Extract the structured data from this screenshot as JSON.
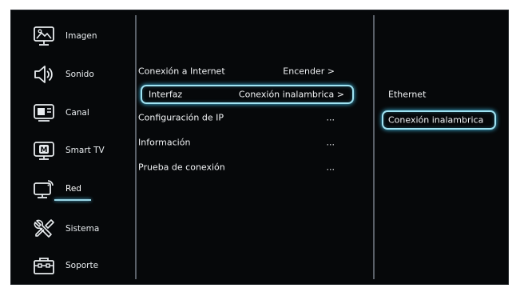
{
  "sidebar": {
    "items": [
      {
        "label": "Imagen",
        "icon": "picture-icon"
      },
      {
        "label": "Sonido",
        "icon": "speaker-icon"
      },
      {
        "label": "Canal",
        "icon": "channel-icon"
      },
      {
        "label": "Smart TV",
        "icon": "smart-tv-icon"
      },
      {
        "label": "Red",
        "icon": "network-icon"
      },
      {
        "label": "Sistema",
        "icon": "tools-icon"
      },
      {
        "label": "Soporte",
        "icon": "toolbox-icon"
      }
    ],
    "selected": "Red"
  },
  "menu": {
    "rows": [
      {
        "label": "Conexión a Internet",
        "value": "Encender  >"
      },
      {
        "label": "Interfaz",
        "value": "Conexión inalambrica  >"
      },
      {
        "label": "Configuración de IP",
        "value": "..."
      },
      {
        "label": "Información",
        "value": "..."
      },
      {
        "label": "Prueba de conexión",
        "value": "..."
      }
    ],
    "focused": "Interfaz"
  },
  "options": {
    "items": [
      {
        "label": "Ethernet"
      },
      {
        "label": "Conexión inalambrica"
      }
    ],
    "selected": "Conexión inalambrica"
  },
  "colors": {
    "background": "#06080a",
    "text": "#f2f4f6",
    "focus_border": "#9fe3f2",
    "focus_glow": "#43c6ef"
  }
}
